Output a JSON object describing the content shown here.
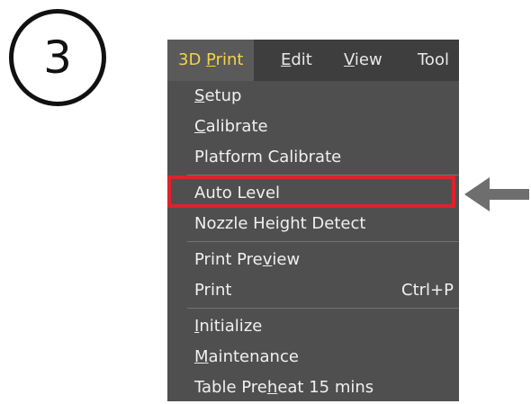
{
  "step": {
    "number": "3"
  },
  "menubar": {
    "items": [
      {
        "pre": "3D ",
        "mnemonic": "P",
        "post": "rint"
      },
      {
        "pre": "",
        "mnemonic": "E",
        "post": "dit"
      },
      {
        "pre": "",
        "mnemonic": "V",
        "post": "iew"
      },
      {
        "pre": "Tool",
        "mnemonic": "",
        "post": ""
      }
    ]
  },
  "dropdown": {
    "items": [
      {
        "pre": "",
        "mnemonic": "S",
        "post": "etup"
      },
      {
        "pre": "",
        "mnemonic": "C",
        "post": "alibrate"
      },
      {
        "pre": "Platform Calibrate",
        "mnemonic": "",
        "post": ""
      },
      {
        "pre": "Auto Level",
        "mnemonic": "",
        "post": ""
      },
      {
        "pre": "Nozzle Height Detect",
        "mnemonic": "",
        "post": ""
      },
      {
        "pre": "Print Pre",
        "mnemonic": "v",
        "post": "iew"
      },
      {
        "pre": "Print",
        "mnemonic": "",
        "post": "",
        "shortcut": "Ctrl+P"
      },
      {
        "pre": "",
        "mnemonic": "I",
        "post": "nitialize"
      },
      {
        "pre": "",
        "mnemonic": "M",
        "post": "aintenance"
      },
      {
        "pre": "Table Pre",
        "mnemonic": "h",
        "post": "eat 15 mins"
      }
    ]
  },
  "colors": {
    "menu_background": "#4f4f4f",
    "menubar_background": "#3e3e3e",
    "active_menu_text": "#f3d34a",
    "highlight_border": "#e0212b",
    "arrow": "#6e6e6e"
  },
  "icons": {
    "pointer": "arrow-left-icon"
  }
}
